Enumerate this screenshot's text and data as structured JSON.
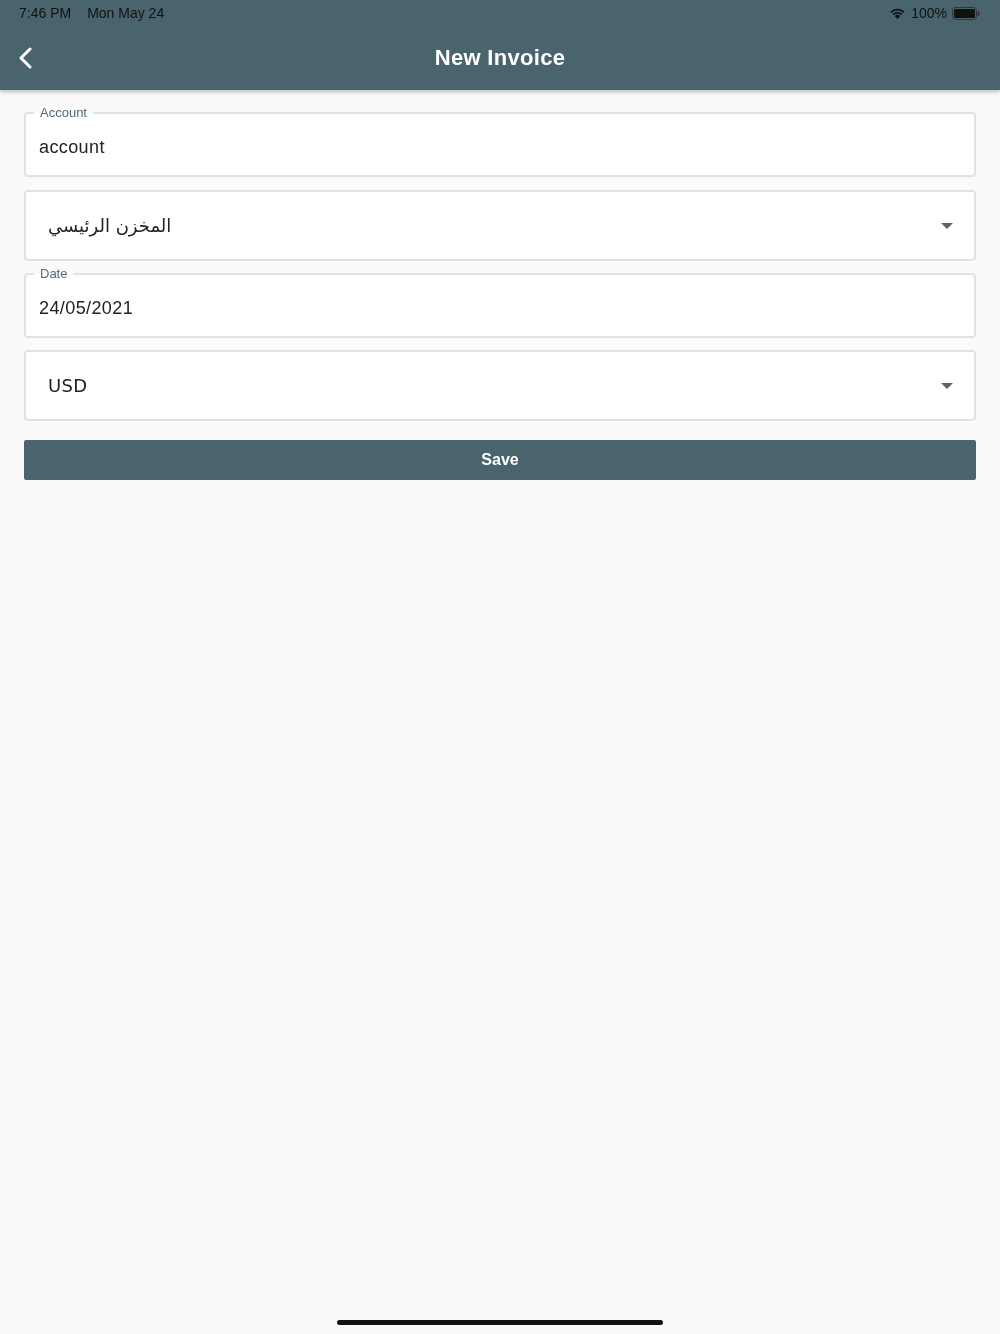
{
  "status_bar": {
    "time": "7:46 PM",
    "date": "Mon May 24",
    "battery": "100%"
  },
  "app_bar": {
    "title": "New Invoice"
  },
  "form": {
    "fields": [
      {
        "kind": "text",
        "label": "Account",
        "value": "account"
      },
      {
        "kind": "dropdown",
        "value": "المخزن الرئيسي"
      },
      {
        "kind": "text",
        "label": "Date",
        "value": "24/05/2021"
      },
      {
        "kind": "dropdown",
        "value": "USD"
      }
    ]
  },
  "save_button": {
    "label": "Save"
  }
}
